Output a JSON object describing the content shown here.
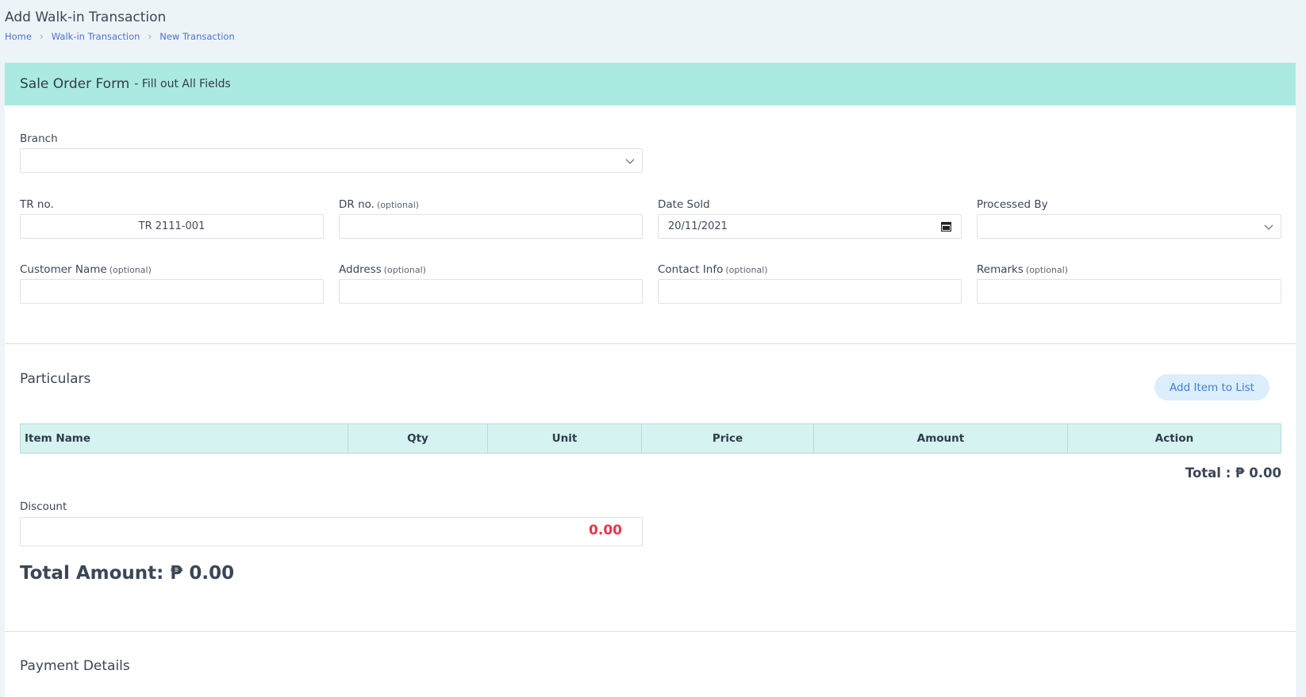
{
  "page": {
    "title": "Add Walk-in Transaction",
    "breadcrumb": [
      "Home",
      "Walk-in Transaction",
      "New Transaction"
    ]
  },
  "form": {
    "header_title": "Sale Order Form",
    "header_subtitle": "- Fill out All Fields",
    "branch": {
      "label": "Branch",
      "value": ""
    },
    "tr_no": {
      "label": "TR no.",
      "value": "TR 2111-001"
    },
    "dr_no": {
      "label": "DR no.",
      "optional": "(optional)",
      "value": ""
    },
    "date_sold": {
      "label": "Date Sold",
      "value": "20/11/2021"
    },
    "processed_by": {
      "label": "Processed By",
      "value": ""
    },
    "customer_name": {
      "label": "Customer Name",
      "optional": "(optional)",
      "value": ""
    },
    "address": {
      "label": "Address",
      "optional": "(optional)",
      "value": ""
    },
    "contact_info": {
      "label": "Contact Info",
      "optional": "(optional)",
      "value": ""
    },
    "remarks": {
      "label": "Remarks",
      "optional": "(optional)",
      "value": ""
    }
  },
  "particulars": {
    "title": "Particulars",
    "add_button": "Add Item to List",
    "columns": [
      "Item Name",
      "Qty",
      "Unit",
      "Price",
      "Amount",
      "Action"
    ],
    "total": "Total : ₱ 0.00"
  },
  "discount": {
    "label": "Discount",
    "value": "0.00"
  },
  "total_amount": "Total Amount: ₱ 0.00",
  "payment": {
    "title": "Payment Details"
  },
  "colors": {
    "header_bg": "#abeae0",
    "table_header_bg": "#d5f3f1",
    "discount_value": "#e2374a",
    "link": "#4a73c9",
    "button_bg": "#dcedfb",
    "button_text": "#3c7fd3"
  }
}
